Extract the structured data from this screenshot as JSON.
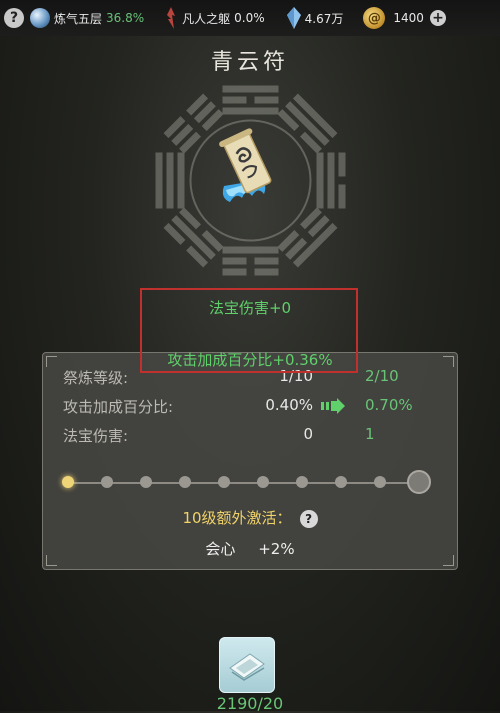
{
  "topbar": {
    "help_icon": "question-mark",
    "realm_label": "炼气五层",
    "realm_progress": "36.8%",
    "body_label": "凡人之躯",
    "body_progress": "0.0%",
    "spirit_stones": "4.67万",
    "coins": "1400",
    "plus": "+"
  },
  "title": "青云符",
  "bonus": {
    "line1": "法宝伤害+0",
    "line2": "攻击加成百分比+0.36%"
  },
  "stats": [
    {
      "label": "祭炼等级:",
      "current": "1/10",
      "next": "2/10"
    },
    {
      "label": "攻击加成百分比:",
      "current": "0.40%",
      "next": "0.70%"
    },
    {
      "label": "法宝伤害:",
      "current": "0",
      "next": "1"
    }
  ],
  "refine_progress": {
    "current_level": 1,
    "max_level": 10
  },
  "extra": {
    "activation_label": "10级额外激活：",
    "help": "?",
    "stat_name": "会心",
    "stat_value": "+2%"
  },
  "material": {
    "count": "2190/20"
  },
  "colors": {
    "green": "#5fd06a",
    "gold": "#f0d36a",
    "highlight_border": "#c0312d"
  }
}
